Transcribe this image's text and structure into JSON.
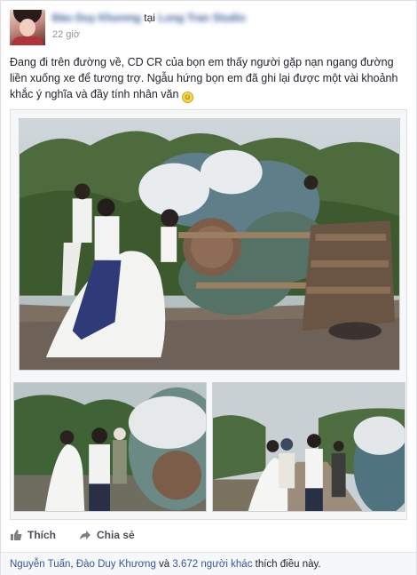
{
  "post": {
    "author": "Đào Duy Khương",
    "at_word": "tại",
    "location": "Long Tran Studio",
    "timestamp": "22 giờ",
    "text": "Đang đi trên đường về, CD CR của bọn em thấy người gặp nạn ngang đường liền xuống xe để tương trợ. Ngẫu hứng bọn em đã ghi lại được một vài khoảnh khắc ý nghĩa và đầy tính nhân văn",
    "emoji": "smile-emoji"
  },
  "actions": {
    "like_label": "Thích",
    "share_label": "Chia sẻ",
    "like_icon": "thumbs-up-icon",
    "share_icon": "share-arrow-icon"
  },
  "likes": {
    "names_1": "Nguyễn Tuấn",
    "separator": ", ",
    "names_2": "Đào Duy Khương",
    "and_word": " và ",
    "others": "3.672 người khác",
    "suffix": " thích điều này."
  },
  "colors": {
    "link": "#365899",
    "text": "#1d2129",
    "muted": "#90949c",
    "background": "#ffffff"
  }
}
